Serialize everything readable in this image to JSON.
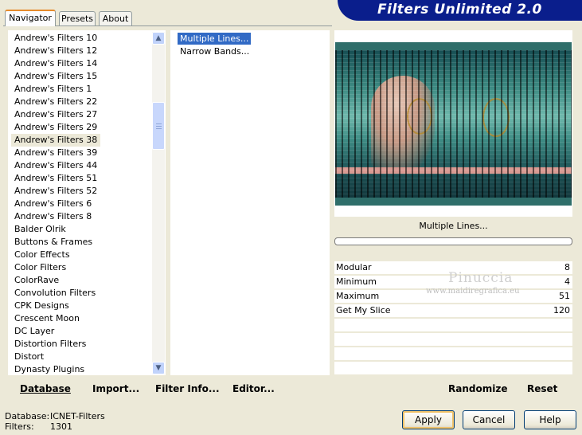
{
  "header": {
    "title": "Filters Unlimited 2.0"
  },
  "tabs": [
    {
      "label": "Navigator"
    },
    {
      "label": "Presets"
    },
    {
      "label": "About"
    }
  ],
  "categories": {
    "items": [
      "Andrew's Filters 10",
      "Andrew's Filters 12",
      "Andrew's Filters 14",
      "Andrew's Filters 15",
      "Andrew's Filters 1",
      "Andrew's Filters 22",
      "Andrew's Filters 27",
      "Andrew's Filters 29",
      "Andrew's Filters 38",
      "Andrew's Filters 39",
      "Andrew's Filters 44",
      "Andrew's Filters 51",
      "Andrew's Filters 52",
      "Andrew's Filters 6",
      "Andrew's Filters 8",
      "Balder Olrik",
      "Buttons & Frames",
      "Color Effects",
      "Color Filters",
      "ColorRave",
      "Convolution Filters",
      "CPK Designs",
      "Crescent Moon",
      "DC Layer",
      "Distortion Filters",
      "Distort",
      "Dynasty Plugins"
    ],
    "selected": "Andrew's Filters 38"
  },
  "filters": {
    "items": [
      "Multiple Lines...",
      "Narrow Bands..."
    ],
    "selected": "Multiple Lines..."
  },
  "left_toolbar": {
    "database": "Database",
    "import": "Import...",
    "filter_info": "Filter Info...",
    "editor": "Editor..."
  },
  "preview": {
    "filter_title": "Multiple Lines..."
  },
  "params": [
    {
      "name": "Modular",
      "value": "8"
    },
    {
      "name": "Minimum",
      "value": "4"
    },
    {
      "name": "Maximum",
      "value": "51"
    },
    {
      "name": "Get My Slice",
      "value": "120"
    }
  ],
  "watermark": {
    "name": "Pinuccia",
    "url": "www.maidiregrafica.eu"
  },
  "right_toolbar": {
    "randomize": "Randomize",
    "reset": "Reset"
  },
  "footer": {
    "database_label": "Database:",
    "database_value": "ICNET-Filters",
    "filters_label": "Filters:",
    "filters_value": "1301"
  },
  "buttons": {
    "apply": "Apply",
    "cancel": "Cancel",
    "help": "Help"
  },
  "colors": {
    "banner": "#0a1e8c",
    "selection": "#316ac5",
    "tab_highlight": "#e68b2c"
  }
}
